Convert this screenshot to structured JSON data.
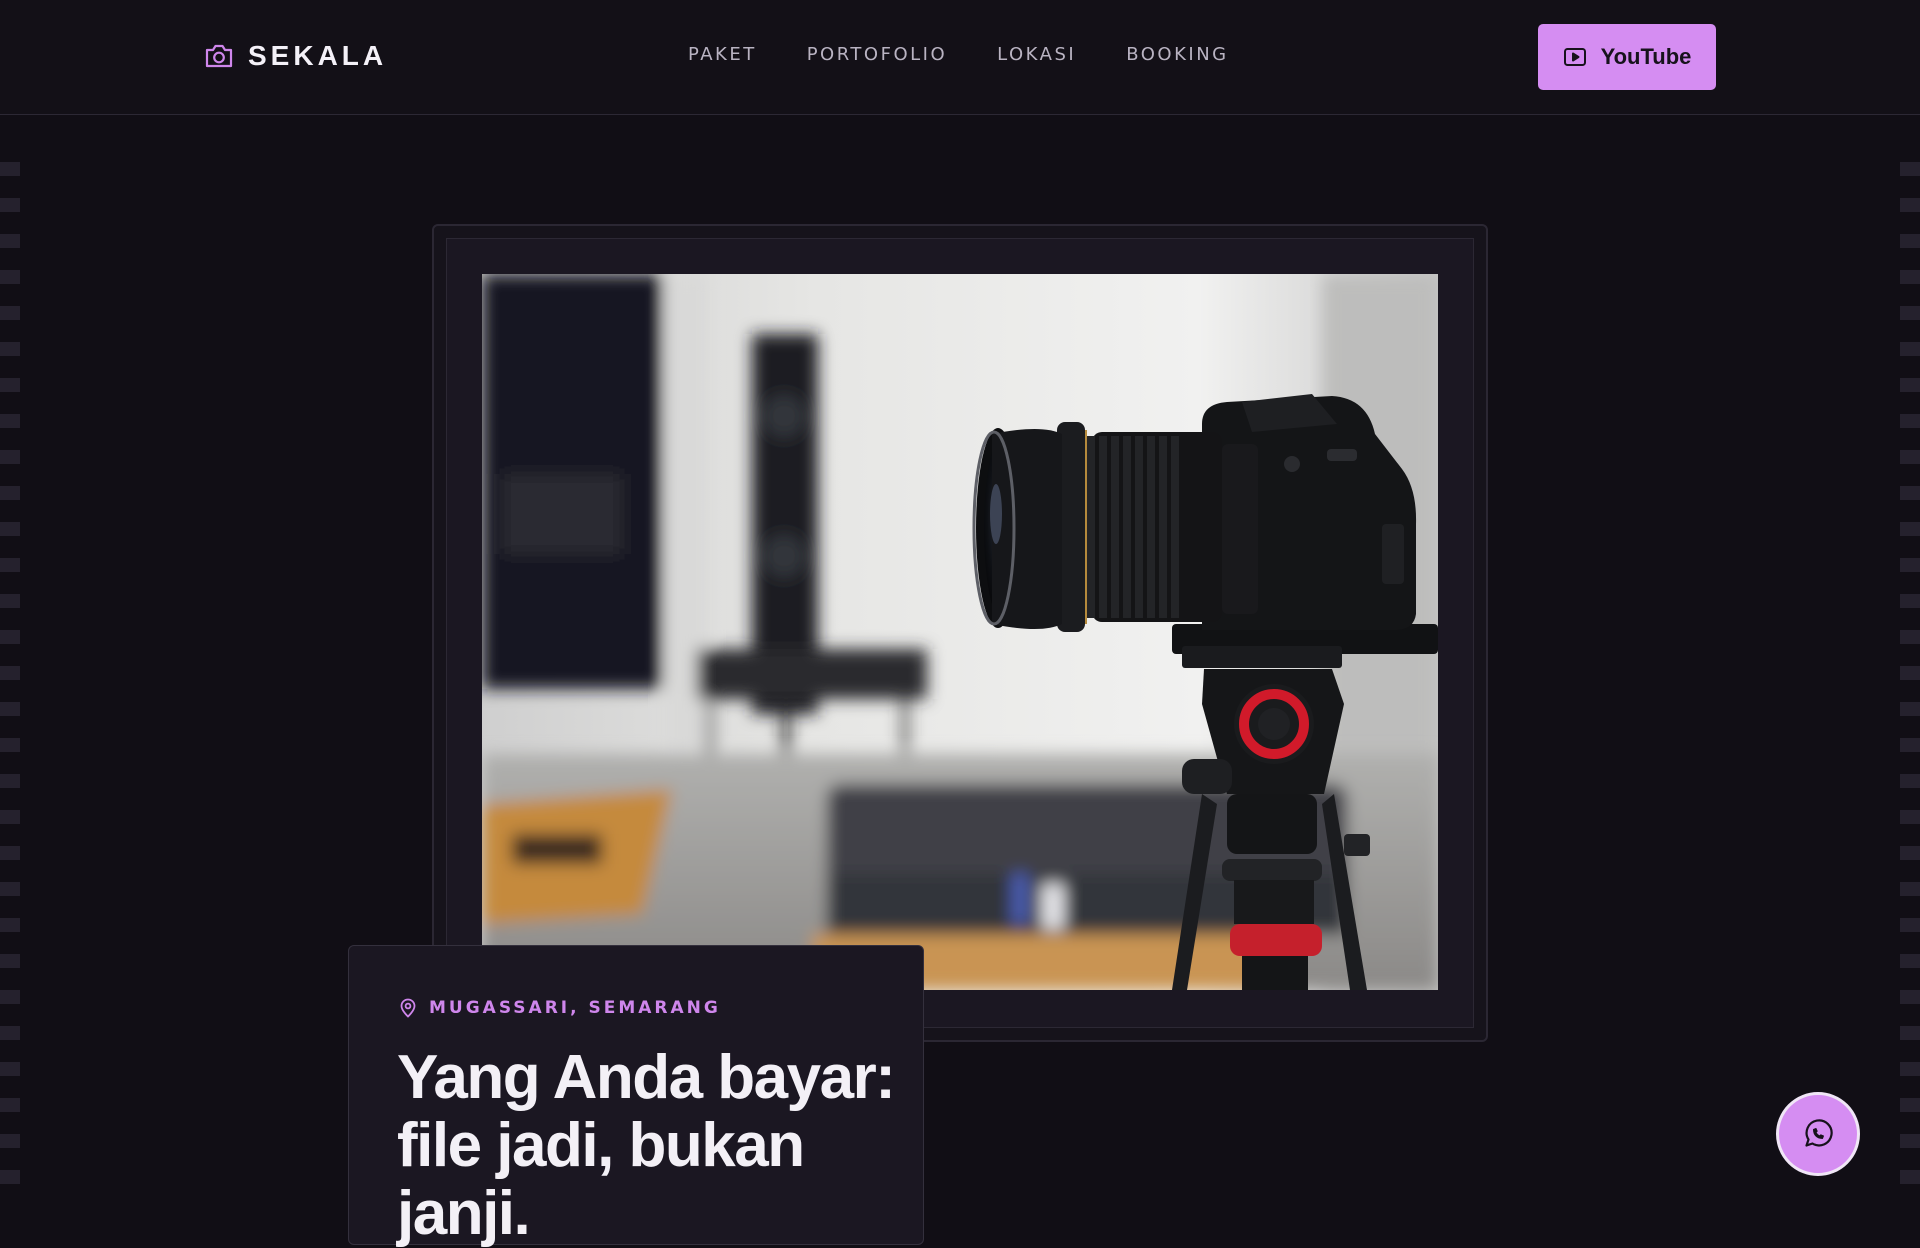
{
  "header": {
    "brand": "SEKALA",
    "nav": [
      "PAKET",
      "PORTOFOLIO",
      "LOKASI",
      "BOOKING"
    ],
    "cta_label": "YouTube"
  },
  "hero": {
    "location": "MUGASSARI, SEMARANG",
    "headline": "Yang Anda bayar: file jadi, bukan janji."
  },
  "icons": {
    "brand": "camera-icon",
    "cta": "play-square-icon",
    "location": "map-pin-icon",
    "fab": "whatsapp-icon"
  },
  "colors": {
    "background": "#110e15",
    "accent": "#d58df2",
    "accent_text": "#cf86ec"
  }
}
